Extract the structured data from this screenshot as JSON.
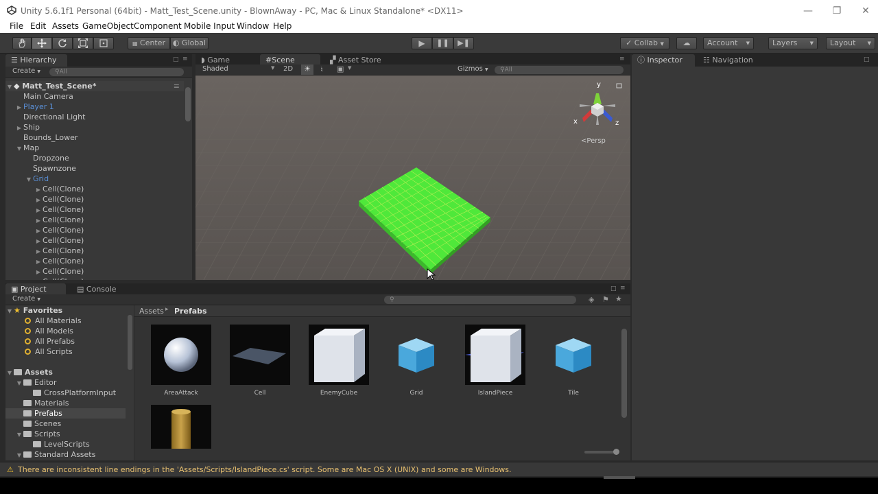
{
  "window": {
    "title": "Unity 5.6.1f1 Personal (64bit) - Matt_Test_Scene.unity - BlownAway - PC, Mac & Linux Standalone* <DX11>"
  },
  "menu": [
    "File",
    "Edit",
    "Assets",
    "GameObject",
    "Component",
    "Mobile Input",
    "Window",
    "Help"
  ],
  "toolbar": {
    "center": "Center",
    "global": "Global",
    "collab": "Collab",
    "account": "Account",
    "layers": "Layers",
    "layout": "Layout"
  },
  "hierarchy": {
    "tab": "Hierarchy",
    "create": "Create",
    "search": "All",
    "scene": "Matt_Test_Scene*",
    "items": [
      {
        "label": "Main Camera",
        "indent": 0,
        "arrow": "",
        "blue": false
      },
      {
        "label": "Player 1",
        "indent": 0,
        "arrow": "right",
        "blue": true
      },
      {
        "label": "Directional Light",
        "indent": 0,
        "arrow": "",
        "blue": false
      },
      {
        "label": "Ship",
        "indent": 0,
        "arrow": "right",
        "blue": false
      },
      {
        "label": "Bounds_Lower",
        "indent": 0,
        "arrow": "",
        "blue": false
      },
      {
        "label": "Map",
        "indent": 0,
        "arrow": "down",
        "blue": false
      },
      {
        "label": "Dropzone",
        "indent": 1,
        "arrow": "",
        "blue": false
      },
      {
        "label": "Spawnzone",
        "indent": 1,
        "arrow": "",
        "blue": false
      },
      {
        "label": "Grid",
        "indent": 1,
        "arrow": "down",
        "blue": true
      },
      {
        "label": "Cell(Clone)",
        "indent": 2,
        "arrow": "right",
        "blue": false
      },
      {
        "label": "Cell(Clone)",
        "indent": 2,
        "arrow": "right",
        "blue": false
      },
      {
        "label": "Cell(Clone)",
        "indent": 2,
        "arrow": "right",
        "blue": false
      },
      {
        "label": "Cell(Clone)",
        "indent": 2,
        "arrow": "right",
        "blue": false
      },
      {
        "label": "Cell(Clone)",
        "indent": 2,
        "arrow": "right",
        "blue": false
      },
      {
        "label": "Cell(Clone)",
        "indent": 2,
        "arrow": "right",
        "blue": false
      },
      {
        "label": "Cell(Clone)",
        "indent": 2,
        "arrow": "right",
        "blue": false
      },
      {
        "label": "Cell(Clone)",
        "indent": 2,
        "arrow": "right",
        "blue": false
      },
      {
        "label": "Cell(Clone)",
        "indent": 2,
        "arrow": "right",
        "blue": false
      },
      {
        "label": "Cell(Clone)",
        "indent": 2,
        "arrow": "right",
        "blue": false
      }
    ]
  },
  "scene_view": {
    "tabs": [
      "Game",
      "Scene",
      "Asset Store"
    ],
    "shading": "Shaded",
    "mode2d": "2D",
    "gizmos": "Gizmos",
    "search": "All",
    "persp": "Persp",
    "axis_x": "x",
    "axis_y": "y",
    "axis_z": "z"
  },
  "inspector": {
    "tabs": [
      "Inspector",
      "Navigation"
    ]
  },
  "project": {
    "tabs": [
      "Project",
      "Console"
    ],
    "create": "Create",
    "favorites_label": "Favorites",
    "favorites": [
      "All Materials",
      "All Models",
      "All Prefabs",
      "All Scripts"
    ],
    "assets_label": "Assets",
    "folders": [
      {
        "label": "Editor",
        "indent": 1,
        "arrow": "down",
        "selected": false
      },
      {
        "label": "CrossPlatformInput",
        "indent": 2,
        "arrow": "",
        "selected": false
      },
      {
        "label": "Materials",
        "indent": 1,
        "arrow": "",
        "selected": false
      },
      {
        "label": "Prefabs",
        "indent": 1,
        "arrow": "",
        "selected": true
      },
      {
        "label": "Scenes",
        "indent": 1,
        "arrow": "",
        "selected": false
      },
      {
        "label": "Scripts",
        "indent": 1,
        "arrow": "down",
        "selected": false
      },
      {
        "label": "LevelScripts",
        "indent": 2,
        "arrow": "",
        "selected": false
      },
      {
        "label": "Standard Assets",
        "indent": 1,
        "arrow": "down",
        "selected": false
      }
    ],
    "breadcrumb": [
      "Assets",
      "Prefabs"
    ],
    "assets": [
      "AreaAttack",
      "Cell",
      "EnemyCube",
      "Grid",
      "IslandPiece",
      "Tile"
    ]
  },
  "status": {
    "message": "There are inconsistent line endings in the 'Assets/Scripts/IslandPiece.cs' script. Some are Mac OS X (UNIX) and some are Windows."
  },
  "colors": {
    "grid_green": "#4fe83a",
    "warning": "#e8c070",
    "selection_blue": "#5a8fd6"
  }
}
